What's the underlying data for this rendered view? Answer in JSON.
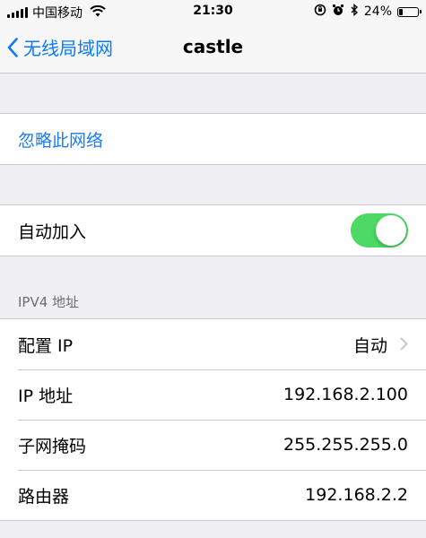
{
  "status_bar": {
    "carrier": "中国移动",
    "time": "21:30",
    "battery_percent": "24%",
    "battery_level": 0.24
  },
  "nav": {
    "back_label": "无线局域网",
    "title": "castle"
  },
  "forget_network": {
    "label": "忽略此网络"
  },
  "auto_join": {
    "label": "自动加入",
    "enabled": true
  },
  "ipv4": {
    "header": "IPV4 地址",
    "rows": [
      {
        "label": "配置 IP",
        "value": "自动"
      },
      {
        "label": "IP 地址",
        "value": "192.168.2.100"
      },
      {
        "label": "子网掩码",
        "value": "255.255.255.0"
      },
      {
        "label": "路由器",
        "value": "192.168.2.2"
      }
    ]
  },
  "colors": {
    "accent": "#0a7aff",
    "toggle_on": "#4cd964",
    "background": "#efeff4"
  }
}
